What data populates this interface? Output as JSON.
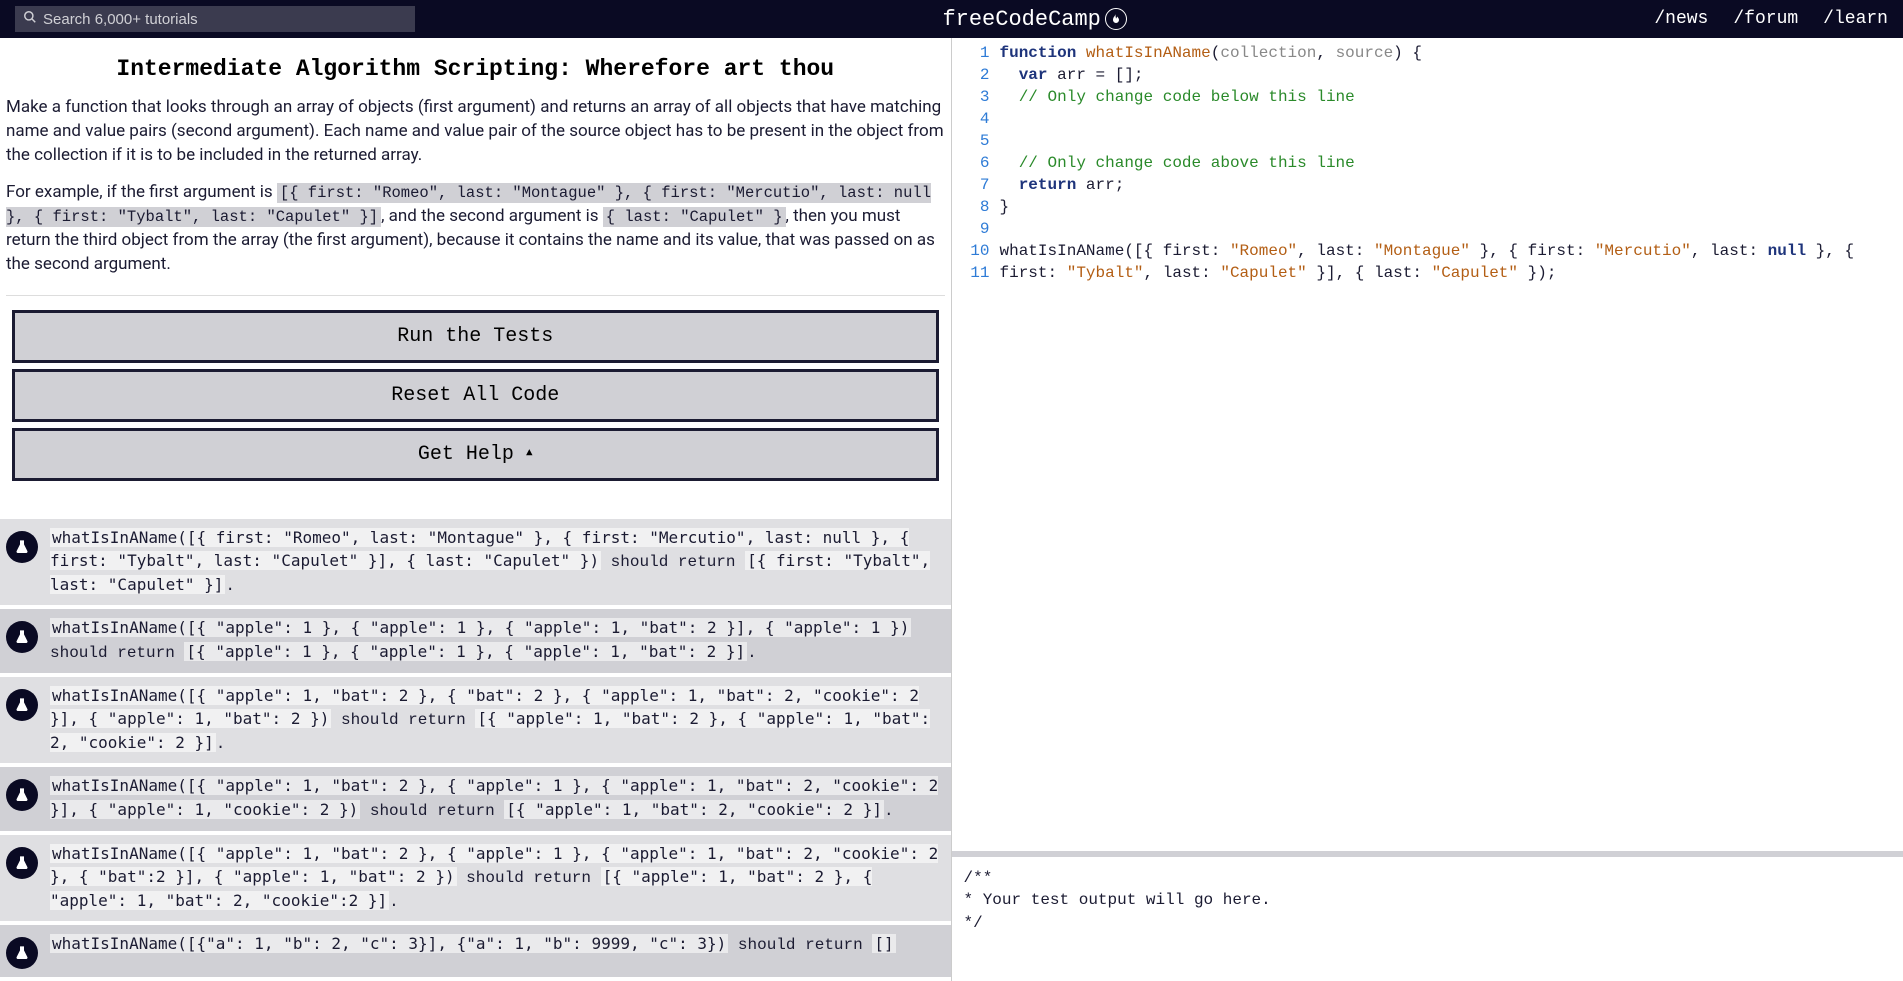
{
  "nav": {
    "search_placeholder": "Search 6,000+ tutorials",
    "logo_text": "freeCodeCamp",
    "links": {
      "news": "/news",
      "forum": "/forum",
      "learn": "/learn"
    }
  },
  "challenge": {
    "title": "Intermediate Algorithm Scripting: Wherefore art thou",
    "p1": "Make a function that looks through an array of objects (first argument) and returns an array of all objects that have matching name and value pairs (second argument). Each name and value pair of the source object has to be present in the object from the collection if it is to be included in the returned array.",
    "p2_pre": "For example, if the first argument is ",
    "p2_code1": "[{ first: \"Romeo\", last: \"Montague\" }, { first: \"Mercutio\", last: null }, { first: \"Tybalt\", last: \"Capulet\" }]",
    "p2_mid": ", and the second argument is ",
    "p2_code2": "{ last: \"Capulet\" }",
    "p2_post": ", then you must return the third object from the array (the first argument), because it contains the name and its value, that was passed on as the second argument."
  },
  "buttons": {
    "run": "Run the Tests",
    "reset": "Reset All Code",
    "help": "Get Help"
  },
  "tests": [
    {
      "c1": "whatIsInAName([{ first: \"Romeo\", last: \"Montague\" }, { first: \"Mercutio\", last: null }, { first: \"Tybalt\", last: \"Capulet\" }], { last: \"Capulet\" })",
      "mid": " should return ",
      "c2": "[{ first: \"Tybalt\", last: \"Capulet\" }]",
      "post": "."
    },
    {
      "c1": "whatIsInAName([{ \"apple\": 1 }, { \"apple\": 1 }, { \"apple\": 1, \"bat\": 2 }], { \"apple\": 1 })",
      "mid": " should return ",
      "c2": "[{ \"apple\": 1 }, { \"apple\": 1 }, { \"apple\": 1, \"bat\": 2 }]",
      "post": "."
    },
    {
      "c1": "whatIsInAName([{ \"apple\": 1, \"bat\": 2 }, { \"bat\": 2 }, { \"apple\": 1, \"bat\": 2, \"cookie\": 2 }], { \"apple\": 1, \"bat\": 2 })",
      "mid": " should return ",
      "c2": "[{ \"apple\": 1, \"bat\": 2 }, { \"apple\": 1, \"bat\": 2, \"cookie\": 2 }]",
      "post": "."
    },
    {
      "c1": "whatIsInAName([{ \"apple\": 1, \"bat\": 2 }, { \"apple\": 1 }, { \"apple\": 1, \"bat\": 2, \"cookie\": 2 }], { \"apple\": 1, \"cookie\": 2 })",
      "mid": " should return ",
      "c2": "[{ \"apple\": 1, \"bat\": 2, \"cookie\": 2 }]",
      "post": "."
    },
    {
      "c1": "whatIsInAName([{ \"apple\": 1, \"bat\": 2 }, { \"apple\": 1 }, { \"apple\": 1, \"bat\": 2, \"cookie\": 2 }, { \"bat\":2 }], { \"apple\": 1, \"bat\": 2 })",
      "mid": " should return ",
      "c2": "[{ \"apple\": 1, \"bat\": 2 }, { \"apple\": 1, \"bat\": 2, \"cookie\":2 }]",
      "post": "."
    },
    {
      "c1": "whatIsInAName([{\"a\": 1, \"b\": 2, \"c\": 3}], {\"a\": 1, \"b\": 9999, \"c\": 3})",
      "mid": " should return ",
      "c2": "[]",
      "post": ""
    }
  ],
  "editor": {
    "lines": [
      "1",
      "2",
      "3",
      "4",
      "5",
      "6",
      "7",
      "8",
      "9",
      "10",
      "",
      "11"
    ]
  },
  "code": {
    "l1_kw": "function",
    "l1_fn": " whatIsInAName",
    "l1_open": "(",
    "l1_p1": "collection",
    "l1_comma": ", ",
    "l1_p2": "source",
    "l1_close": ") {",
    "l2_kw": "var",
    "l2_rest": " arr = [];",
    "l3": "// Only change code below this line",
    "l6": "// Only change code above this line",
    "l7_kw": "return",
    "l7_rest": " arr;",
    "l8": "}",
    "l10a": "whatIsInAName([{ first: ",
    "l10s1": "\"Romeo\"",
    "l10b": ", last: ",
    "l10s2": "\"Montague\"",
    "l10c": " }, { first: ",
    "l10s3": "\"Mercutio\"",
    "l10d": ", last: ",
    "l10n1": "null",
    "l10e": " }, { first: ",
    "l10s4": "\"Tybalt\"",
    "l10f": ", last: ",
    "l10s5": "\"Capulet\"",
    "l10g": " }], { last: ",
    "l10s6": "\"Capulet\"",
    "l10h": " });"
  },
  "output": {
    "l1": "/**",
    "l2": "* Your test output will go here.",
    "l3": "*/"
  }
}
